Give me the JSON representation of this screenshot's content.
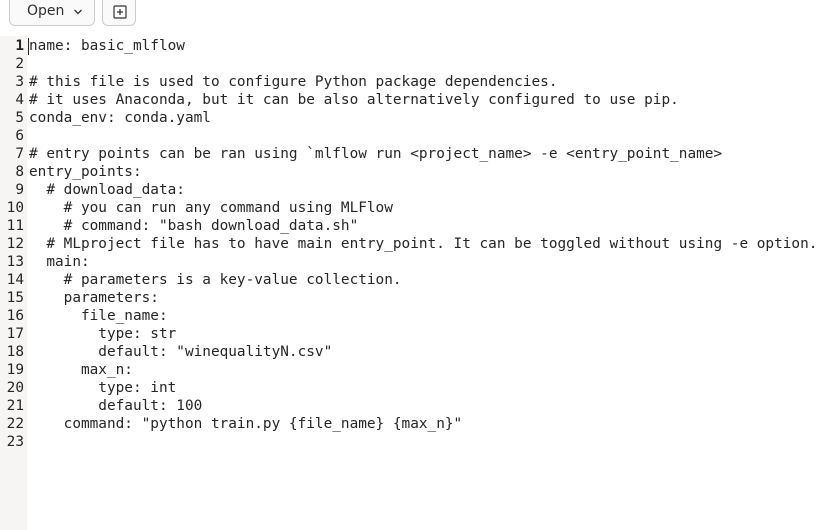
{
  "toolbar": {
    "open_label": "Open",
    "open_dropdown_icon": "chevron-down-icon",
    "new_tab_icon": "new-document-icon"
  },
  "editor": {
    "current_line": 1,
    "lines": [
      {
        "n": "1",
        "text": "name: basic_mlflow"
      },
      {
        "n": "2",
        "text": ""
      },
      {
        "n": "3",
        "text": "# this file is used to configure Python package dependencies."
      },
      {
        "n": "4",
        "text": "# it uses Anaconda, but it can be also alternatively configured to use pip."
      },
      {
        "n": "5",
        "text": "conda_env: conda.yaml"
      },
      {
        "n": "6",
        "text": ""
      },
      {
        "n": "7",
        "text": "# entry points can be ran using `mlflow run <project_name> -e <entry_point_name>"
      },
      {
        "n": "8",
        "text": "entry_points:"
      },
      {
        "n": "9",
        "text": "  # download_data:"
      },
      {
        "n": "10",
        "text": "    # you can run any command using MLFlow"
      },
      {
        "n": "11",
        "text": "    # command: \"bash download_data.sh\""
      },
      {
        "n": "12",
        "text": "  # MLproject file has to have main entry_point. It can be toggled without using -e option."
      },
      {
        "n": "13",
        "text": "  main:"
      },
      {
        "n": "14",
        "text": "    # parameters is a key-value collection."
      },
      {
        "n": "15",
        "text": "    parameters:"
      },
      {
        "n": "16",
        "text": "      file_name:"
      },
      {
        "n": "17",
        "text": "        type: str"
      },
      {
        "n": "18",
        "text": "        default: \"winequalityN.csv\""
      },
      {
        "n": "19",
        "text": "      max_n:"
      },
      {
        "n": "20",
        "text": "        type: int"
      },
      {
        "n": "21",
        "text": "        default: 100"
      },
      {
        "n": "22",
        "text": "    command: \"python train.py {file_name} {max_n}\""
      },
      {
        "n": "23",
        "text": ""
      }
    ]
  }
}
